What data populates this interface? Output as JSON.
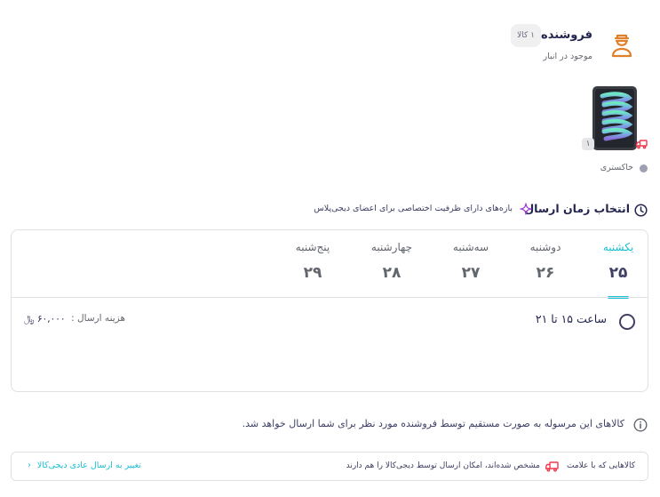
{
  "seller": {
    "title": "فروشنده",
    "item_count": "۱ کالا",
    "stock_status": "موجود در انبار",
    "icon": "seller-person-icon"
  },
  "product": {
    "image_alt": "tablet-product-image",
    "quantity": "۱",
    "color_label": "خاکستری",
    "color_hex": "#9e9fb1"
  },
  "delivery": {
    "title": "انتخاب زمان ارسال",
    "plus_note": "بازه‌های دارای ظرفیت اختصاصی برای اعضای دیجی‌پلاس",
    "days": [
      {
        "name": "یکشنبه",
        "num": "۲۵",
        "active": true
      },
      {
        "name": "دوشنبه",
        "num": "۲۶",
        "active": false
      },
      {
        "name": "سه‌شنبه",
        "num": "۲۷",
        "active": false
      },
      {
        "name": "چهارشنبه",
        "num": "۲۸",
        "active": false
      },
      {
        "name": "پنج‌شنبه",
        "num": "۲۹",
        "active": false
      }
    ],
    "slot_label": "ساعت ۱۵ تا ۲۱",
    "cost_label": "هزینه ارسال :",
    "cost_value": "۶۰,۰۰۰ ﷼"
  },
  "info": {
    "text": "کالاهای این مرسوله به صورت مستقیم توسط فروشنده مورد نظر برای شما ارسال خواهد شد."
  },
  "footer": {
    "note_part_a": "کالاهایی که با علامت",
    "note_part_b": "مشخص شده‌اند، امکان ارسال توسط دیجی‌کالا را هم دارند",
    "change_link": "تغییر به ارسال عادی دیجی‌کالا"
  },
  "colors": {
    "accent": "#19bfd3",
    "brand_red": "#ef394e",
    "seller_orange": "#e1802b",
    "text_primary": "#23254e"
  }
}
